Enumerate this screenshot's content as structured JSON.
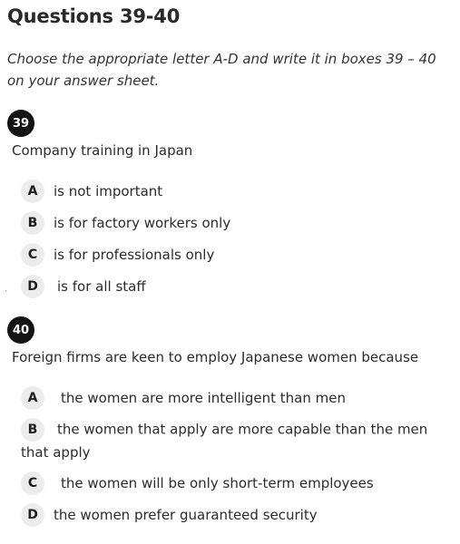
{
  "title": "Questions 39-40",
  "instructions": "Choose the appropriate letter A-D and write it in boxes 39 – 40 on your answer sheet.",
  "questions": [
    {
      "number": "39",
      "text": "Company training in Japan",
      "options": [
        {
          "letter": "A",
          "text": "is not important"
        },
        {
          "letter": "B",
          "text": "is for factory workers only"
        },
        {
          "letter": "C",
          "text": "is for professionals only"
        },
        {
          "letter": "D",
          "text": "is for all staff"
        }
      ]
    },
    {
      "number": "40",
      "text": "Foreign firms are keen to employ Japanese women because",
      "options": [
        {
          "letter": "A",
          "text": "the women are more intelligent than men"
        },
        {
          "letter": "B",
          "text": "the women that apply are more capable than the men that apply"
        },
        {
          "letter": "C",
          "text": "the women will be only short-term employees"
        },
        {
          "letter": "D",
          "text": "the women prefer guaranteed security"
        }
      ]
    }
  ]
}
